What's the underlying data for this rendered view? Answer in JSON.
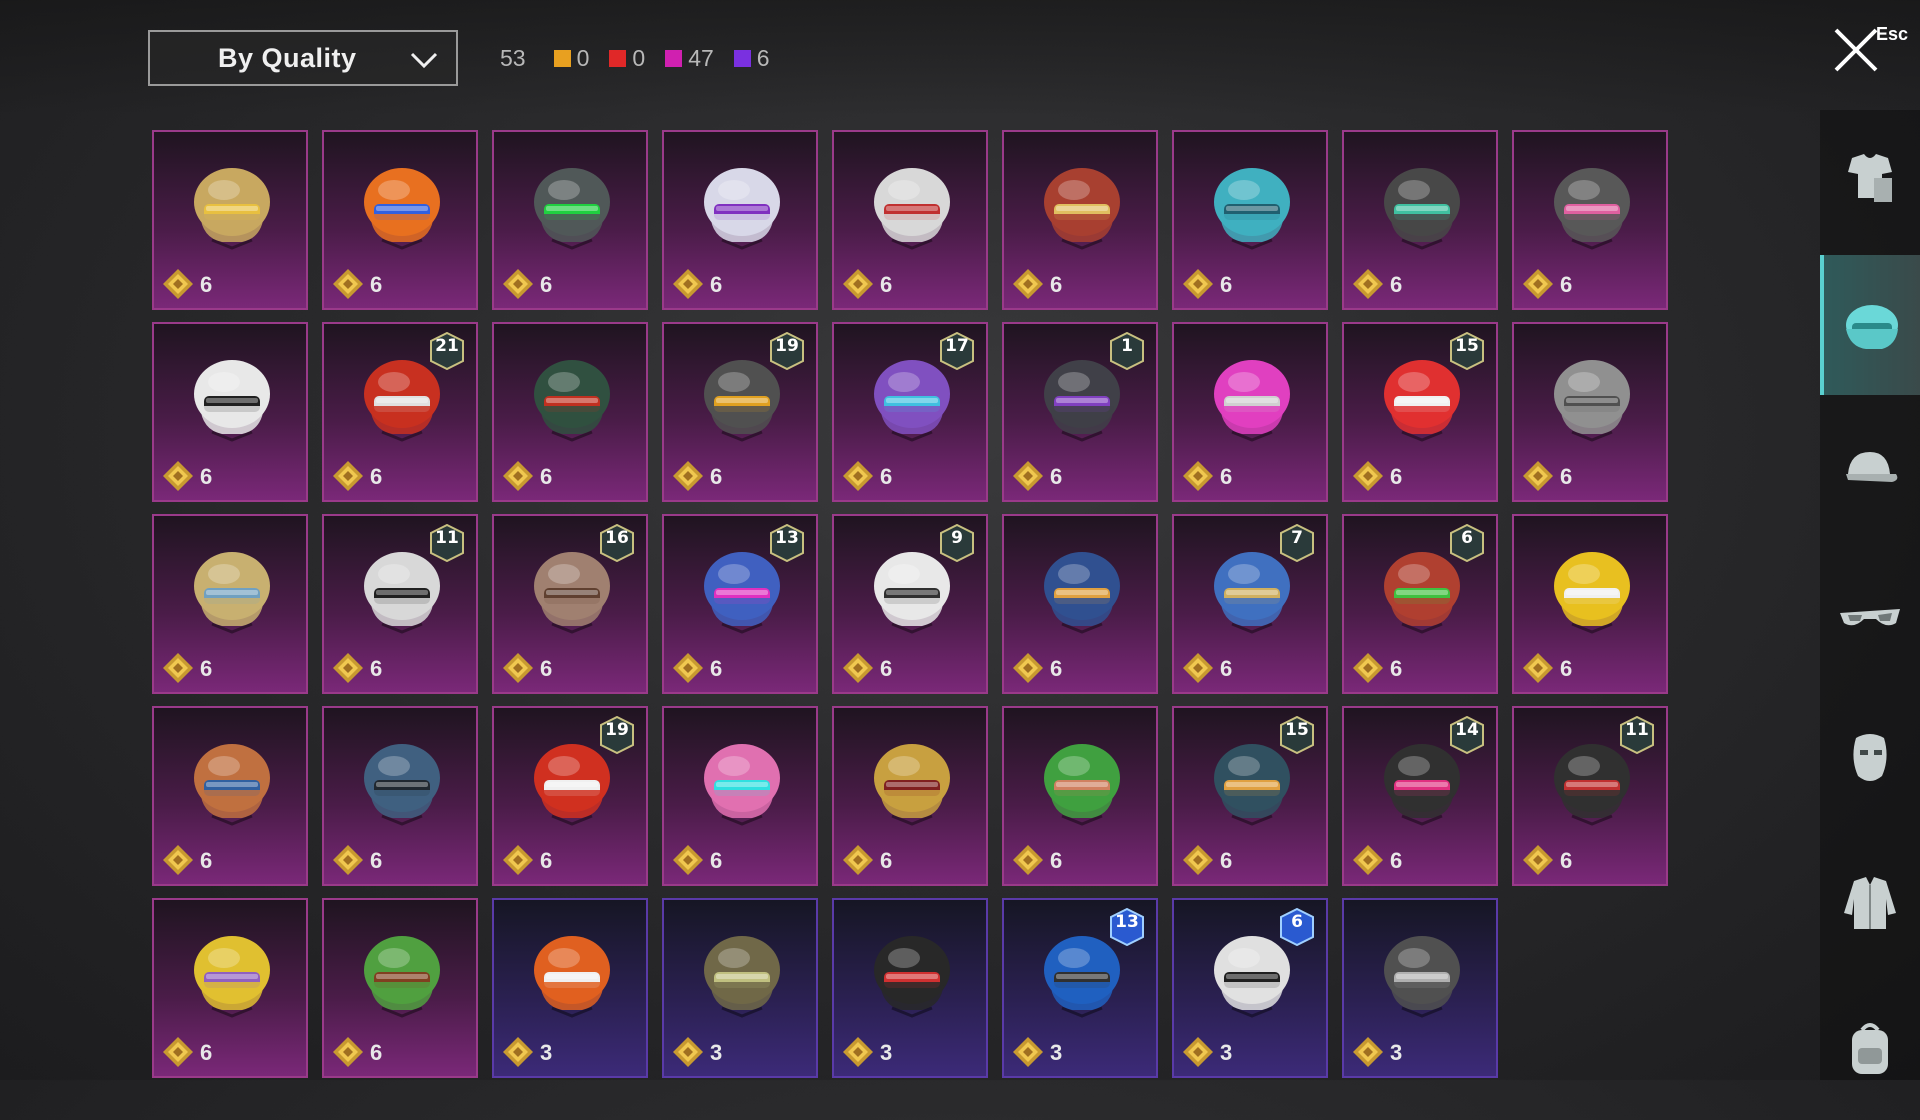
{
  "toolbar": {
    "sort_label": "By Quality",
    "total_count": "53",
    "rarity_counts": [
      {
        "color": "#e8a020",
        "value": "0"
      },
      {
        "color": "#e02828",
        "value": "0"
      },
      {
        "color": "#d020b0",
        "value": "47"
      },
      {
        "color": "#7a30e0",
        "value": "6"
      }
    ],
    "close_label": "Esc"
  },
  "items": [
    {
      "cost": "6",
      "rarity": "purple",
      "badge": "",
      "helmet": "#c8a860",
      "accent": "#e8c040"
    },
    {
      "cost": "6",
      "rarity": "purple",
      "badge": "",
      "helmet": "#e87020",
      "accent": "#3060e0"
    },
    {
      "cost": "6",
      "rarity": "purple",
      "badge": "",
      "helmet": "#505858",
      "accent": "#20d040"
    },
    {
      "cost": "6",
      "rarity": "purple",
      "badge": "",
      "helmet": "#d8d8e8",
      "accent": "#8030c0"
    },
    {
      "cost": "6",
      "rarity": "purple",
      "badge": "",
      "helmet": "#d8d8d8",
      "accent": "#c03030"
    },
    {
      "cost": "6",
      "rarity": "purple",
      "badge": "",
      "helmet": "#a84030",
      "accent": "#e0c060"
    },
    {
      "cost": "6",
      "rarity": "purple",
      "badge": "",
      "helmet": "#40b0c0",
      "accent": "#206070"
    },
    {
      "cost": "6",
      "rarity": "purple",
      "badge": "",
      "helmet": "#484848",
      "accent": "#40c0a0"
    },
    {
      "cost": "6",
      "rarity": "purple",
      "badge": "",
      "helmet": "#585858",
      "accent": "#e060a0"
    },
    {
      "cost": "6",
      "rarity": "purple",
      "badge": "",
      "helmet": "#e8e8e8",
      "accent": "#202020"
    },
    {
      "cost": "6",
      "rarity": "purple",
      "badge": "21",
      "helmet": "#c83020",
      "accent": "#e0e0e0"
    },
    {
      "cost": "6",
      "rarity": "purple",
      "badge": "",
      "helmet": "#305040",
      "accent": "#c03020"
    },
    {
      "cost": "6",
      "rarity": "purple",
      "badge": "19",
      "helmet": "#505050",
      "accent": "#e0a020"
    },
    {
      "cost": "6",
      "rarity": "purple",
      "badge": "17",
      "helmet": "#8050c0",
      "accent": "#40c0e0"
    },
    {
      "cost": "6",
      "rarity": "purple",
      "badge": "1",
      "helmet": "#404048",
      "accent": "#8040c0"
    },
    {
      "cost": "6",
      "rarity": "purple",
      "badge": "",
      "helmet": "#e040c0",
      "accent": "#d0d0d0"
    },
    {
      "cost": "6",
      "rarity": "purple",
      "badge": "15",
      "helmet": "#e03030",
      "accent": "#f0f0f0"
    },
    {
      "cost": "6",
      "rarity": "purple",
      "badge": "",
      "helmet": "#909090",
      "accent": "#505050"
    },
    {
      "cost": "6",
      "rarity": "purple",
      "badge": "",
      "helmet": "#c8b070",
      "accent": "#70a0c0"
    },
    {
      "cost": "6",
      "rarity": "purple",
      "badge": "11",
      "helmet": "#d8d8d8",
      "accent": "#202020"
    },
    {
      "cost": "6",
      "rarity": "purple",
      "badge": "16",
      "helmet": "#a08070",
      "accent": "#604030"
    },
    {
      "cost": "6",
      "rarity": "purple",
      "badge": "13",
      "helmet": "#4060c0",
      "accent": "#e030c0"
    },
    {
      "cost": "6",
      "rarity": "purple",
      "badge": "9",
      "helmet": "#e8e8e8",
      "accent": "#303030"
    },
    {
      "cost": "6",
      "rarity": "purple",
      "badge": "",
      "helmet": "#305090",
      "accent": "#e0a040"
    },
    {
      "cost": "6",
      "rarity": "purple",
      "badge": "7",
      "helmet": "#4070c0",
      "accent": "#d0b060"
    },
    {
      "cost": "6",
      "rarity": "purple",
      "badge": "6",
      "helmet": "#b04030",
      "accent": "#40c040"
    },
    {
      "cost": "6",
      "rarity": "purple",
      "badge": "",
      "helmet": "#e8c020",
      "accent": "#f0f0f0"
    },
    {
      "cost": "6",
      "rarity": "purple",
      "badge": "",
      "helmet": "#c07040",
      "accent": "#3060a0"
    },
    {
      "cost": "6",
      "rarity": "purple",
      "badge": "",
      "helmet": "#406080",
      "accent": "#202830"
    },
    {
      "cost": "6",
      "rarity": "purple",
      "badge": "19",
      "helmet": "#d03020",
      "accent": "#f0f0f0"
    },
    {
      "cost": "6",
      "rarity": "purple",
      "badge": "",
      "helmet": "#e070b0",
      "accent": "#30e0e0"
    },
    {
      "cost": "6",
      "rarity": "purple",
      "badge": "",
      "helmet": "#c8a040",
      "accent": "#802020"
    },
    {
      "cost": "6",
      "rarity": "purple",
      "badge": "",
      "helmet": "#40a040",
      "accent": "#d08060"
    },
    {
      "cost": "6",
      "rarity": "purple",
      "badge": "15",
      "helmet": "#305060",
      "accent": "#e0a040"
    },
    {
      "cost": "6",
      "rarity": "purple",
      "badge": "14",
      "helmet": "#303030",
      "accent": "#e03080"
    },
    {
      "cost": "6",
      "rarity": "purple",
      "badge": "11",
      "helmet": "#303030",
      "accent": "#c03030"
    },
    {
      "cost": "6",
      "rarity": "purple",
      "badge": "",
      "helmet": "#e0c030",
      "accent": "#9060c0"
    },
    {
      "cost": "6",
      "rarity": "purple",
      "badge": "",
      "helmet": "#50a040",
      "accent": "#804020"
    },
    {
      "cost": "3",
      "rarity": "blue",
      "badge": "",
      "helmet": "#e06020",
      "accent": "#f0f0f0"
    },
    {
      "cost": "3",
      "rarity": "blue",
      "badge": "",
      "helmet": "#706848",
      "accent": "#c0c080"
    },
    {
      "cost": "3",
      "rarity": "blue",
      "badge": "",
      "helmet": "#282828",
      "accent": "#d03030"
    },
    {
      "cost": "3",
      "rarity": "blue",
      "badge": "13",
      "helmet": "#2060c0",
      "accent": "#303030"
    },
    {
      "cost": "3",
      "rarity": "blue",
      "badge": "6",
      "helmet": "#e0e0e0",
      "accent": "#202020"
    },
    {
      "cost": "3",
      "rarity": "blue",
      "badge": "",
      "helmet": "#505050",
      "accent": "#b0b0b0"
    }
  ],
  "sidebar_tabs": [
    {
      "name": "outfit-tab",
      "icon": "outfit-icon",
      "active": false
    },
    {
      "name": "helmet-tab",
      "icon": "helmet-icon",
      "active": true
    },
    {
      "name": "hat-tab",
      "icon": "cap-icon",
      "active": false
    },
    {
      "name": "glasses-tab",
      "icon": "glasses-icon",
      "active": false
    },
    {
      "name": "mask-tab",
      "icon": "mask-icon",
      "active": false
    },
    {
      "name": "jacket-tab",
      "icon": "jacket-icon",
      "active": false
    },
    {
      "name": "backpack-tab",
      "icon": "backpack-icon",
      "active": false
    }
  ]
}
